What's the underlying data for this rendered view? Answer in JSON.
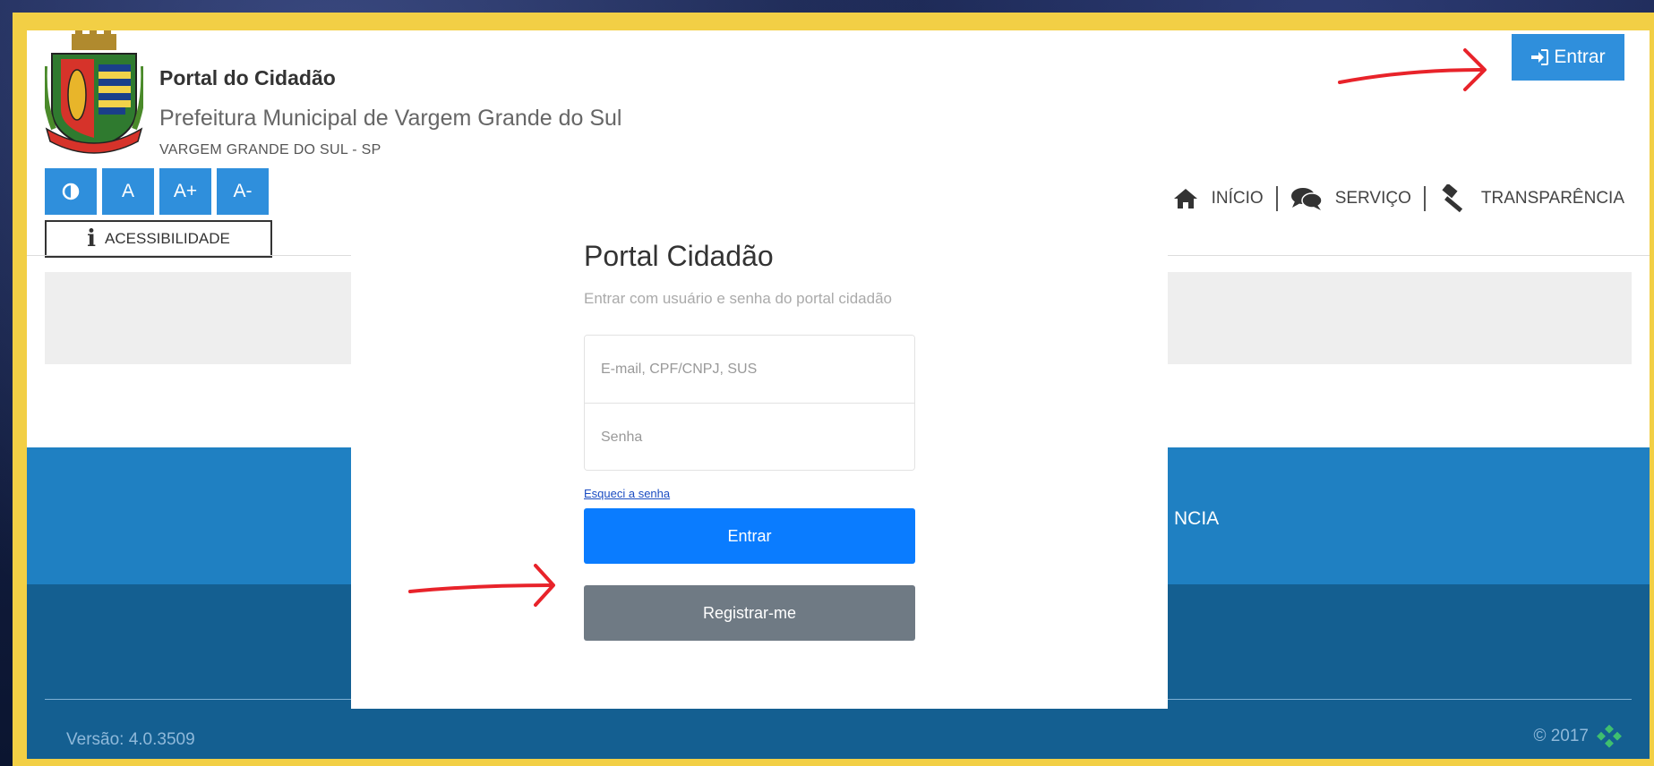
{
  "header": {
    "title": "Portal do Cidadão",
    "subtitle": "Prefeitura Municipal de Vargem Grande do Sul",
    "city": "VARGEM GRANDE DO SUL - SP",
    "login_button": "Entrar"
  },
  "accessibility": {
    "contrast_icon": "contrast-icon",
    "buttons": [
      "A",
      "A+",
      "A-"
    ],
    "label": "ACESSIBILIDADE"
  },
  "nav": {
    "items": [
      {
        "label": "INÍCIO",
        "icon": "home-icon"
      },
      {
        "label": "SERVIÇO",
        "icon": "comments-icon"
      },
      {
        "label": "TRANSPARÊNCIA",
        "icon": "gavel-icon"
      }
    ]
  },
  "modal": {
    "title": "Portal Cidadão",
    "subtitle": "Entrar com usuário e senha do portal cidadão",
    "email_placeholder": "E-mail, CPF/CNPJ, SUS",
    "password_placeholder": "Senha",
    "forgot_link": "Esqueci a senha",
    "login_button": "Entrar",
    "register_button": "Registrar-me"
  },
  "footer": {
    "nav_fragment": "NCIA",
    "version": "Versão: 4.0.3509",
    "copyright": "© 2017"
  },
  "colors": {
    "primary": "#2f8fdc",
    "modal_primary": "#0a7cff",
    "secondary": "#6f7a84",
    "footer_top": "#1f80c2",
    "footer_bottom": "#145f91",
    "frame": "#f2cf45",
    "annotation": "#e8232a"
  }
}
